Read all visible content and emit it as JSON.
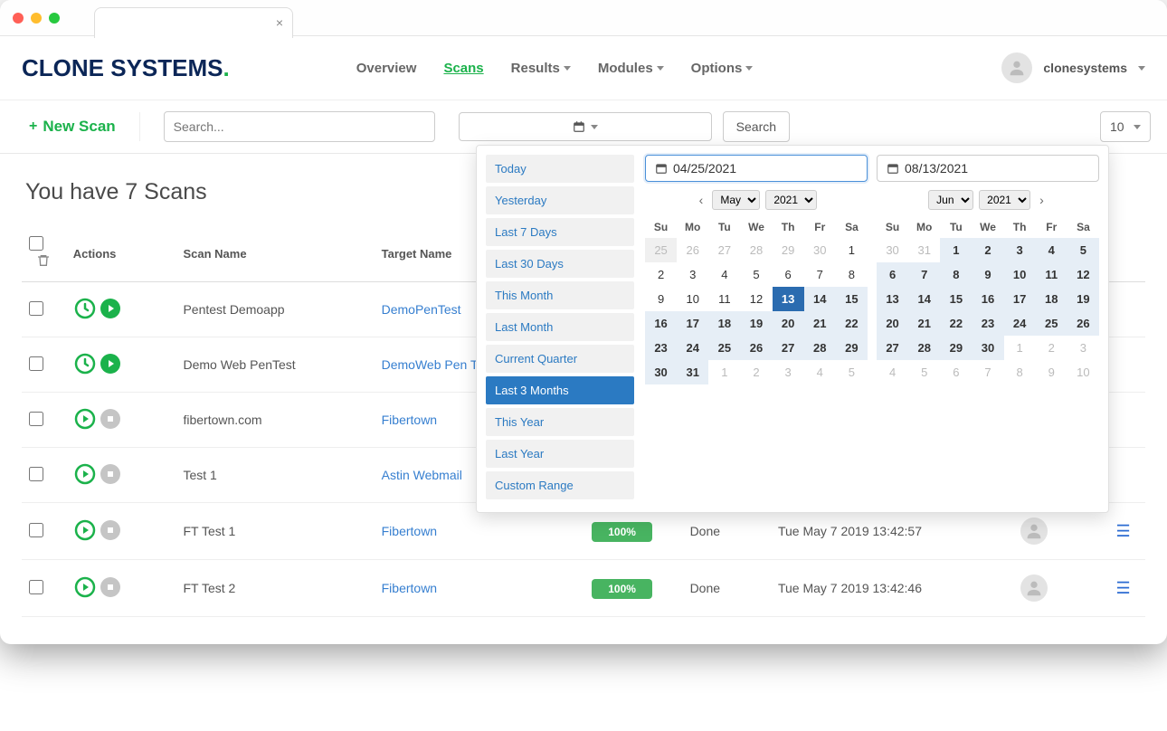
{
  "logo_text": "CLONE SYSTEMS",
  "logo_dot": ".",
  "nav": {
    "overview": "Overview",
    "scans": "Scans",
    "results": "Results",
    "modules": "Modules",
    "options": "Options"
  },
  "user": {
    "name": "clonesystems"
  },
  "toolbar": {
    "new_scan": "New Scan",
    "search_placeholder": "Search...",
    "search_btn": "Search",
    "row_count": "10"
  },
  "page_title": "You have 7 Scans",
  "columns": {
    "actions": "Actions",
    "scan_name": "Scan Name",
    "target_name": "Target Name",
    "progress": "",
    "status": "",
    "date": "",
    "user": "",
    "menu": ""
  },
  "rows": [
    {
      "scan_name": "Pentest Demoapp",
      "target_name": "DemoPenTest",
      "progress": "",
      "status": "",
      "date": "",
      "icons": "clock-play"
    },
    {
      "scan_name": "Demo Web PenTest",
      "target_name": "DemoWeb Pen Test",
      "progress": "",
      "status": "",
      "date": "",
      "icons": "clock-play"
    },
    {
      "scan_name": "fibertown.com",
      "target_name": "Fibertown",
      "progress": "",
      "status": "",
      "date": "",
      "icons": "play-stop"
    },
    {
      "scan_name": "Test 1",
      "target_name": "Astin Webmail",
      "progress": "",
      "status": "",
      "date": "",
      "icons": "play-stop"
    },
    {
      "scan_name": "FT Test 1",
      "target_name": "Fibertown",
      "progress": "100%",
      "status": "Done",
      "date": "Tue May 7 2019 13:42:57",
      "icons": "play-stop"
    },
    {
      "scan_name": "FT Test 2",
      "target_name": "Fibertown",
      "progress": "100%",
      "status": "Done",
      "date": "Tue May 7 2019 13:42:46",
      "icons": "play-stop"
    }
  ],
  "daterange": {
    "presets": [
      "Today",
      "Yesterday",
      "Last 7 Days",
      "Last 30 Days",
      "This Month",
      "Last Month",
      "Current Quarter",
      "Last 3 Months",
      "This Year",
      "Last Year",
      "Custom Range"
    ],
    "active_preset": "Last 3 Months",
    "left": {
      "value": "04/25/2021",
      "month": "May",
      "year": "2021"
    },
    "right": {
      "value": "08/13/2021",
      "month": "Jun",
      "year": "2021"
    },
    "weekdays": [
      "Su",
      "Mo",
      "Tu",
      "We",
      "Th",
      "Fr",
      "Sa"
    ],
    "cal_left": [
      [
        {
          "d": 25,
          "c": "off-bg"
        },
        {
          "d": 26,
          "c": "off"
        },
        {
          "d": 27,
          "c": "off"
        },
        {
          "d": 28,
          "c": "off"
        },
        {
          "d": 29,
          "c": "off"
        },
        {
          "d": 30,
          "c": "off"
        },
        {
          "d": 1,
          "c": ""
        }
      ],
      [
        {
          "d": 2,
          "c": ""
        },
        {
          "d": 3,
          "c": ""
        },
        {
          "d": 4,
          "c": ""
        },
        {
          "d": 5,
          "c": ""
        },
        {
          "d": 6,
          "c": ""
        },
        {
          "d": 7,
          "c": ""
        },
        {
          "d": 8,
          "c": ""
        }
      ],
      [
        {
          "d": 9,
          "c": ""
        },
        {
          "d": 10,
          "c": ""
        },
        {
          "d": 11,
          "c": ""
        },
        {
          "d": 12,
          "c": ""
        },
        {
          "d": 13,
          "c": "sel"
        },
        {
          "d": 14,
          "c": "range"
        },
        {
          "d": 15,
          "c": "range"
        }
      ],
      [
        {
          "d": 16,
          "c": "range"
        },
        {
          "d": 17,
          "c": "range"
        },
        {
          "d": 18,
          "c": "range"
        },
        {
          "d": 19,
          "c": "range"
        },
        {
          "d": 20,
          "c": "range"
        },
        {
          "d": 21,
          "c": "range"
        },
        {
          "d": 22,
          "c": "range"
        }
      ],
      [
        {
          "d": 23,
          "c": "range"
        },
        {
          "d": 24,
          "c": "range"
        },
        {
          "d": 25,
          "c": "range"
        },
        {
          "d": 26,
          "c": "range"
        },
        {
          "d": 27,
          "c": "range"
        },
        {
          "d": 28,
          "c": "range"
        },
        {
          "d": 29,
          "c": "range"
        }
      ],
      [
        {
          "d": 30,
          "c": "range"
        },
        {
          "d": 31,
          "c": "range"
        },
        {
          "d": 1,
          "c": "off"
        },
        {
          "d": 2,
          "c": "off"
        },
        {
          "d": 3,
          "c": "off"
        },
        {
          "d": 4,
          "c": "off"
        },
        {
          "d": 5,
          "c": "off"
        }
      ]
    ],
    "cal_right": [
      [
        {
          "d": 30,
          "c": "off"
        },
        {
          "d": 31,
          "c": "off"
        },
        {
          "d": 1,
          "c": "range"
        },
        {
          "d": 2,
          "c": "range"
        },
        {
          "d": 3,
          "c": "range"
        },
        {
          "d": 4,
          "c": "range"
        },
        {
          "d": 5,
          "c": "range"
        }
      ],
      [
        {
          "d": 6,
          "c": "range"
        },
        {
          "d": 7,
          "c": "range"
        },
        {
          "d": 8,
          "c": "range"
        },
        {
          "d": 9,
          "c": "range"
        },
        {
          "d": 10,
          "c": "range"
        },
        {
          "d": 11,
          "c": "range"
        },
        {
          "d": 12,
          "c": "range"
        }
      ],
      [
        {
          "d": 13,
          "c": "range"
        },
        {
          "d": 14,
          "c": "range"
        },
        {
          "d": 15,
          "c": "range"
        },
        {
          "d": 16,
          "c": "range"
        },
        {
          "d": 17,
          "c": "range"
        },
        {
          "d": 18,
          "c": "range"
        },
        {
          "d": 19,
          "c": "range"
        }
      ],
      [
        {
          "d": 20,
          "c": "range"
        },
        {
          "d": 21,
          "c": "range"
        },
        {
          "d": 22,
          "c": "range"
        },
        {
          "d": 23,
          "c": "range"
        },
        {
          "d": 24,
          "c": "range"
        },
        {
          "d": 25,
          "c": "range"
        },
        {
          "d": 26,
          "c": "range"
        }
      ],
      [
        {
          "d": 27,
          "c": "range"
        },
        {
          "d": 28,
          "c": "range"
        },
        {
          "d": 29,
          "c": "range"
        },
        {
          "d": 30,
          "c": "range"
        },
        {
          "d": 1,
          "c": "off"
        },
        {
          "d": 2,
          "c": "off"
        },
        {
          "d": 3,
          "c": "off"
        }
      ],
      [
        {
          "d": 4,
          "c": "off"
        },
        {
          "d": 5,
          "c": "off"
        },
        {
          "d": 6,
          "c": "off"
        },
        {
          "d": 7,
          "c": "off"
        },
        {
          "d": 8,
          "c": "off"
        },
        {
          "d": 9,
          "c": "off"
        },
        {
          "d": 10,
          "c": "off"
        }
      ]
    ]
  }
}
